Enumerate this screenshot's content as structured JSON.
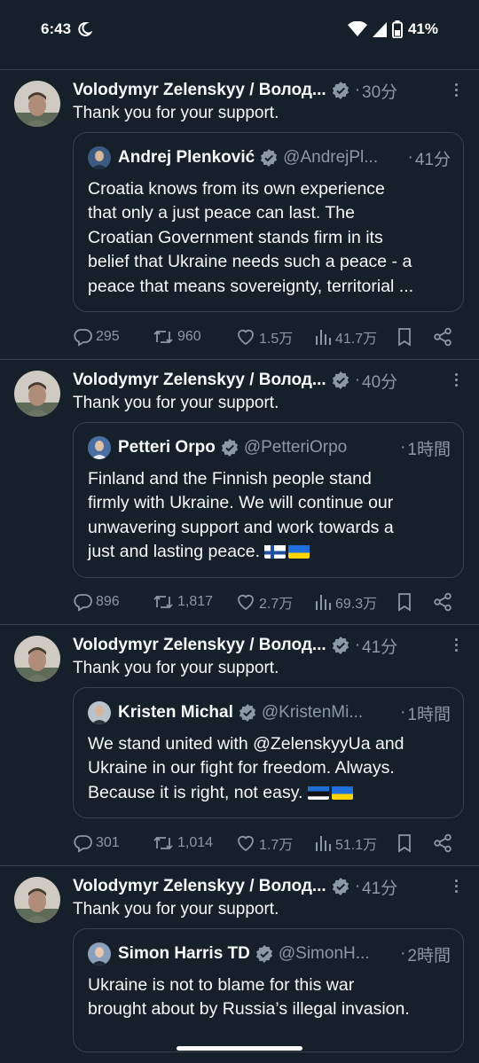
{
  "status_bar": {
    "time": "6:43",
    "battery": "41%"
  },
  "tweets": [
    {
      "name": "Volodymyr Zelenskyy / Волод...",
      "time": "30分",
      "text": "Thank you for your support.",
      "quote": {
        "name": "Andrej Plenković",
        "handle": "@AndrejPl...",
        "time": "41分",
        "lines": [
          "Croatia knows from its own experience",
          "that only a just peace can last. The",
          "Croatian Government stands firm in its",
          "belief that Ukraine needs such a peace - a",
          "peace that means sovereignty, territorial ..."
        ],
        "flags": []
      },
      "replies": "295",
      "retweets": "960",
      "likes": "1.5万",
      "views": "41.7万"
    },
    {
      "name": "Volodymyr Zelenskyy / Волод...",
      "time": "40分",
      "text": "Thank you for your support.",
      "quote": {
        "name": "Petteri Orpo",
        "handle": "@PetteriOrpo",
        "time": "1時間",
        "lines": [
          "Finland and the Finnish people stand",
          "firmly with Ukraine. We will continue our",
          "unwavering support and work towards a",
          "just and lasting peace."
        ],
        "flags": [
          "Finland",
          "Ukraine"
        ]
      },
      "replies": "896",
      "retweets": "1,817",
      "likes": "2.7万",
      "views": "69.3万"
    },
    {
      "name": "Volodymyr Zelenskyy / Волод...",
      "time": "41分",
      "text": "Thank you for your support.",
      "quote": {
        "name": "Kristen Michal",
        "handle": "@KristenMi...",
        "time": "1時間",
        "lines": [
          "We stand united with @ZelenskyyUa and",
          "Ukraine in our fight for freedom. Always.",
          "Because it is right, not easy."
        ],
        "flags": [
          "Estonia",
          "Ukraine"
        ]
      },
      "replies": "301",
      "retweets": "1,014",
      "likes": "1.7万",
      "views": "51.1万"
    },
    {
      "name": "Volodymyr Zelenskyy / Волод...",
      "time": "41分",
      "text": "Thank you for your support.",
      "quote": {
        "name": "Simon Harris TD",
        "handle": "@SimonH...",
        "time": "2時間",
        "lines": [
          "Ukraine is not to blame for this war",
          "brought about by Russia’s illegal invasion."
        ],
        "flags": []
      }
    }
  ],
  "colors": {
    "background": "#15202b",
    "divider": "#38444d",
    "muted": "#8b98a5",
    "verified": "#8b98a5"
  }
}
